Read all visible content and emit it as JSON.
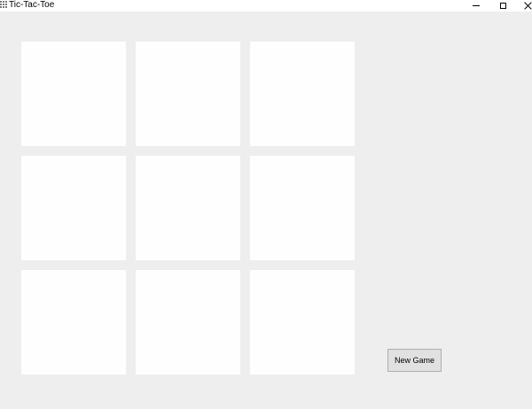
{
  "window": {
    "title": "Tic-Tac-Toe",
    "app_icon": "grid-app-icon",
    "controls": {
      "minimize": "minimize-icon",
      "maximize": "maximize-icon",
      "close": "close-icon"
    }
  },
  "board": {
    "rows": 3,
    "columns": 3,
    "cells": [
      "",
      "",
      "",
      "",
      "",
      "",
      "",
      "",
      ""
    ]
  },
  "actions": {
    "new_game_label": "New Game"
  },
  "colors": {
    "background": "#efeeef",
    "cell": "#fefefe",
    "button": "#e1e1e1",
    "titlebar": "#ffffff"
  }
}
